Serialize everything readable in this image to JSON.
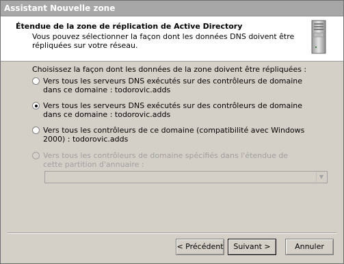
{
  "window": {
    "title": "Assistant Nouvelle zone"
  },
  "header": {
    "title": "Étendue de la zone de réplication de Active Directory",
    "subtitle": "Vous pouvez sélectionner la façon dont les données DNS doivent être répliquées sur votre réseau."
  },
  "content": {
    "prompt": "Choisissez la façon dont les données de la zone doivent être répliquées :",
    "options": [
      {
        "label": "Vers tous les serveurs DNS exécutés sur des contrôleurs de domaine dans ce domaine : todorovic.adds",
        "checked": false,
        "enabled": true
      },
      {
        "label": "Vers tous les serveurs DNS exécutés sur des contrôleurs de domaine dans ce domaine : todorovic.adds",
        "checked": true,
        "enabled": true
      },
      {
        "label": "Vers tous les contrôleurs de ce domaine (compatibilité avec Windows 2000) : todorovic.adds",
        "checked": false,
        "enabled": true
      },
      {
        "label": "Vers tous les contrôleurs de domaine spécifiés dans l'étendue de cette partition d'annuaire :",
        "checked": false,
        "enabled": false
      }
    ],
    "partition_select": {
      "value": "",
      "enabled": false
    }
  },
  "buttons": {
    "back": "< Précédent",
    "next": "Suivant >",
    "cancel": "Annuler"
  },
  "icons": {
    "header_icon": "server-icon",
    "combo_arrow": "chevron-down-icon"
  }
}
